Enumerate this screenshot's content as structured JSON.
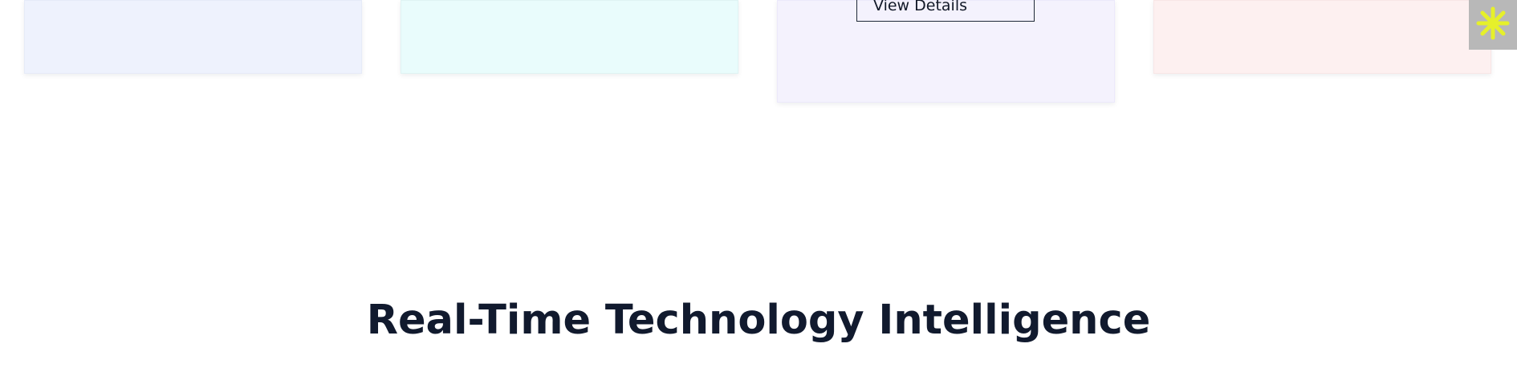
{
  "cards": {
    "card_1": {
      "background": "#eef2fd"
    },
    "card_2": {
      "background": "#e9fcfc"
    },
    "card_3": {
      "background": "#f4f2fd",
      "button_label": "View Details"
    },
    "card_4": {
      "background": "#fdf0f0"
    }
  },
  "corner_badge": {
    "icon": "asterisk-icon",
    "background": "#b8b8b8",
    "icon_color": "#e6f02a"
  },
  "section": {
    "title": "Real-Time Technology Intelligence",
    "subtitle": ""
  }
}
